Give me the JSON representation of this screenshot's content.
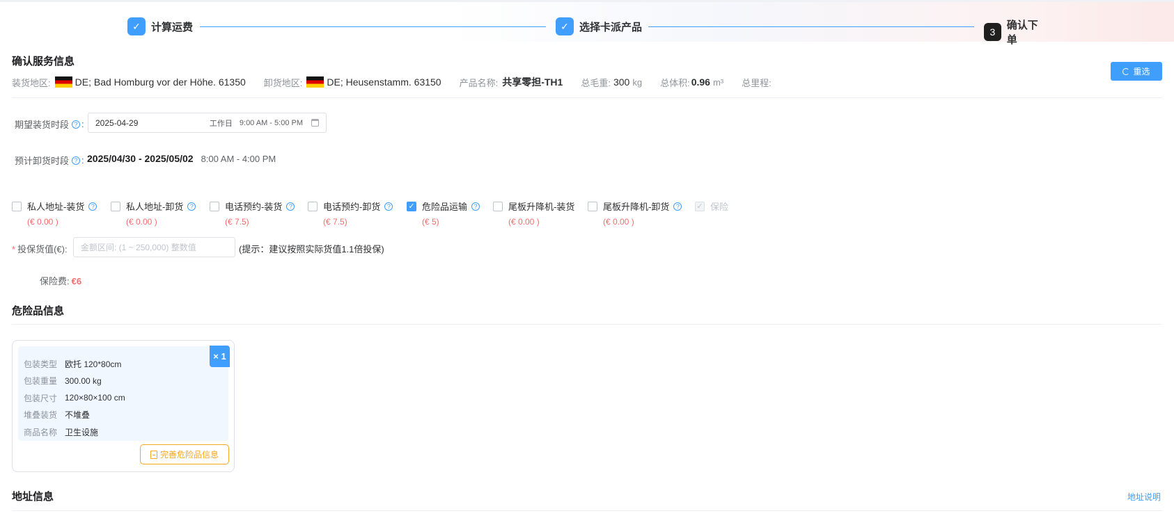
{
  "steps": [
    {
      "label": "计算运费",
      "badge": "✓"
    },
    {
      "label": "选择卡派产品",
      "badge": "✓"
    },
    {
      "label": "确认下单",
      "badge": "3"
    }
  ],
  "service": {
    "title": "确认服务信息",
    "reset_label": "重选",
    "pickup_area_label": "装货地区:",
    "pickup_area_value": "DE; Bad Homburg vor der Höhe. 61350",
    "delivery_area_label": "卸货地区:",
    "delivery_area_value": "DE; Heusenstamm. 63150",
    "product_label": "产品名称:",
    "product_value": "共享零担-TH1",
    "weight_label": "总毛重:",
    "weight_value": "300",
    "weight_unit": "kg",
    "volume_label": "总体积:",
    "volume_value": "0.96",
    "volume_unit": "m³",
    "distance_label": "总里程:",
    "flag_colors": [
      "#111111",
      "#dd0000",
      "#ffce00"
    ]
  },
  "pickup": {
    "label": "期望装货时段",
    "date": "2025-04-29",
    "weekday": "工作日",
    "time": "9:00 AM - 5:00 PM"
  },
  "delivery": {
    "label": "预计卸货时段",
    "range": "2025/04/30 - 2025/05/02",
    "time": "8:00 AM - 4:00 PM"
  },
  "options": [
    {
      "label": "私人地址-装货",
      "price": "(€ 0.00 )",
      "checked": false,
      "help": true
    },
    {
      "label": "私人地址-卸货",
      "price": "(€ 0.00 )",
      "checked": false,
      "help": true
    },
    {
      "label": "电话预约-装货",
      "price": "(€ 7.5)",
      "checked": false,
      "help": true
    },
    {
      "label": "电话预约-卸货",
      "price": "(€ 7.5)",
      "checked": false,
      "help": true
    },
    {
      "label": "危险品运输",
      "price": "(€ 5)",
      "checked": true,
      "help": true
    },
    {
      "label": "尾板升降机-装货",
      "price": "(€ 0.00 )",
      "checked": false,
      "help": false
    },
    {
      "label": "尾板升降机-卸货",
      "price": "(€ 0.00 )",
      "checked": false,
      "help": true
    },
    {
      "label": "保险",
      "price": "",
      "checked": true,
      "disabled": true,
      "help": false
    }
  ],
  "insurance": {
    "required_mark": "*",
    "label": "投保货值(€):",
    "placeholder": "金额区间: (1 ~ 250,000) 整数值",
    "tip": "(提示：建议按照实际货值1.1倍投保)",
    "fee_label": "保险费:",
    "fee_value": "€6"
  },
  "dangerous": {
    "title": "危险品信息",
    "quantity": "× 1",
    "rows": [
      {
        "k": "包装类型",
        "v": "欧托 120*80cm"
      },
      {
        "k": "包装重量",
        "v": "300.00 kg"
      },
      {
        "k": "包装尺寸",
        "v": "120×80×100 cm"
      },
      {
        "k": "堆叠装货",
        "v": "不堆叠"
      },
      {
        "k": "商品名称",
        "v": "卫生设施"
      }
    ],
    "complete_label": "完善危险品信息"
  },
  "address": {
    "title": "地址信息",
    "help_link": "地址说明"
  }
}
